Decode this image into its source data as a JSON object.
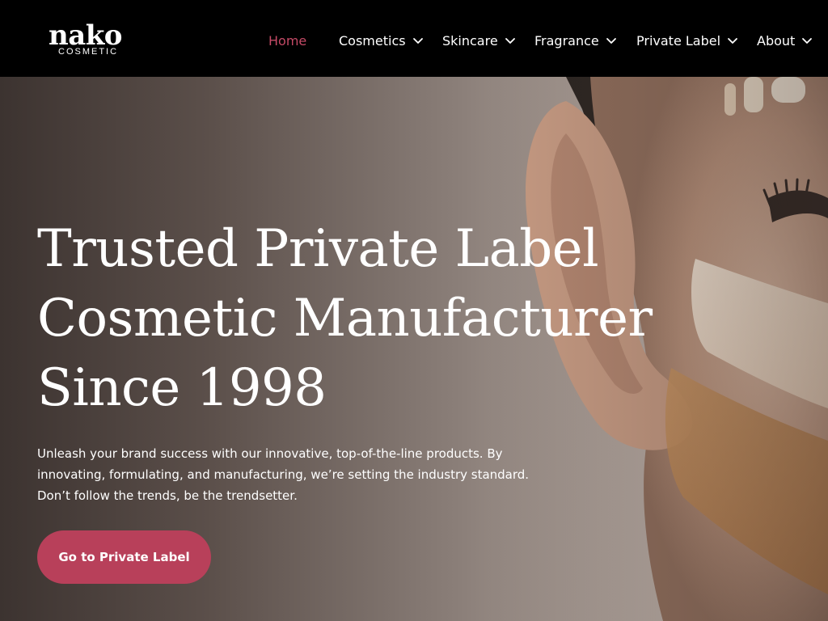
{
  "brand": {
    "name": "nako",
    "subtitle": "COSMETIC"
  },
  "nav": {
    "items": [
      {
        "label": "Home",
        "active": true,
        "has_dropdown": false
      },
      {
        "label": "Cosmetics",
        "active": false,
        "has_dropdown": true
      },
      {
        "label": "Skincare",
        "active": false,
        "has_dropdown": true
      },
      {
        "label": "Fragrance",
        "active": false,
        "has_dropdown": true
      },
      {
        "label": "Private Label",
        "active": false,
        "has_dropdown": true
      },
      {
        "label": "About",
        "active": false,
        "has_dropdown": true
      }
    ],
    "dropdown_icon": "chevron-down-icon"
  },
  "hero": {
    "title_lines": [
      "Trusted Private Label",
      "Cosmetic Manufacturer",
      "Since 1998"
    ],
    "description_lines": [
      "Unleash your brand success with our innovative, top-of-the-line products. By",
      "innovating, formulating, and manufacturing, we’re setting the industry standard.",
      "Don’t follow the trends, be the trendsetter."
    ],
    "cta_label": "Go to Private Label",
    "image": "model-face-with-foundation-swatches"
  },
  "colors": {
    "header_bg": "#000000",
    "accent": "#c44a66",
    "cta_bg": "#b8405a",
    "text": "#ffffff"
  }
}
